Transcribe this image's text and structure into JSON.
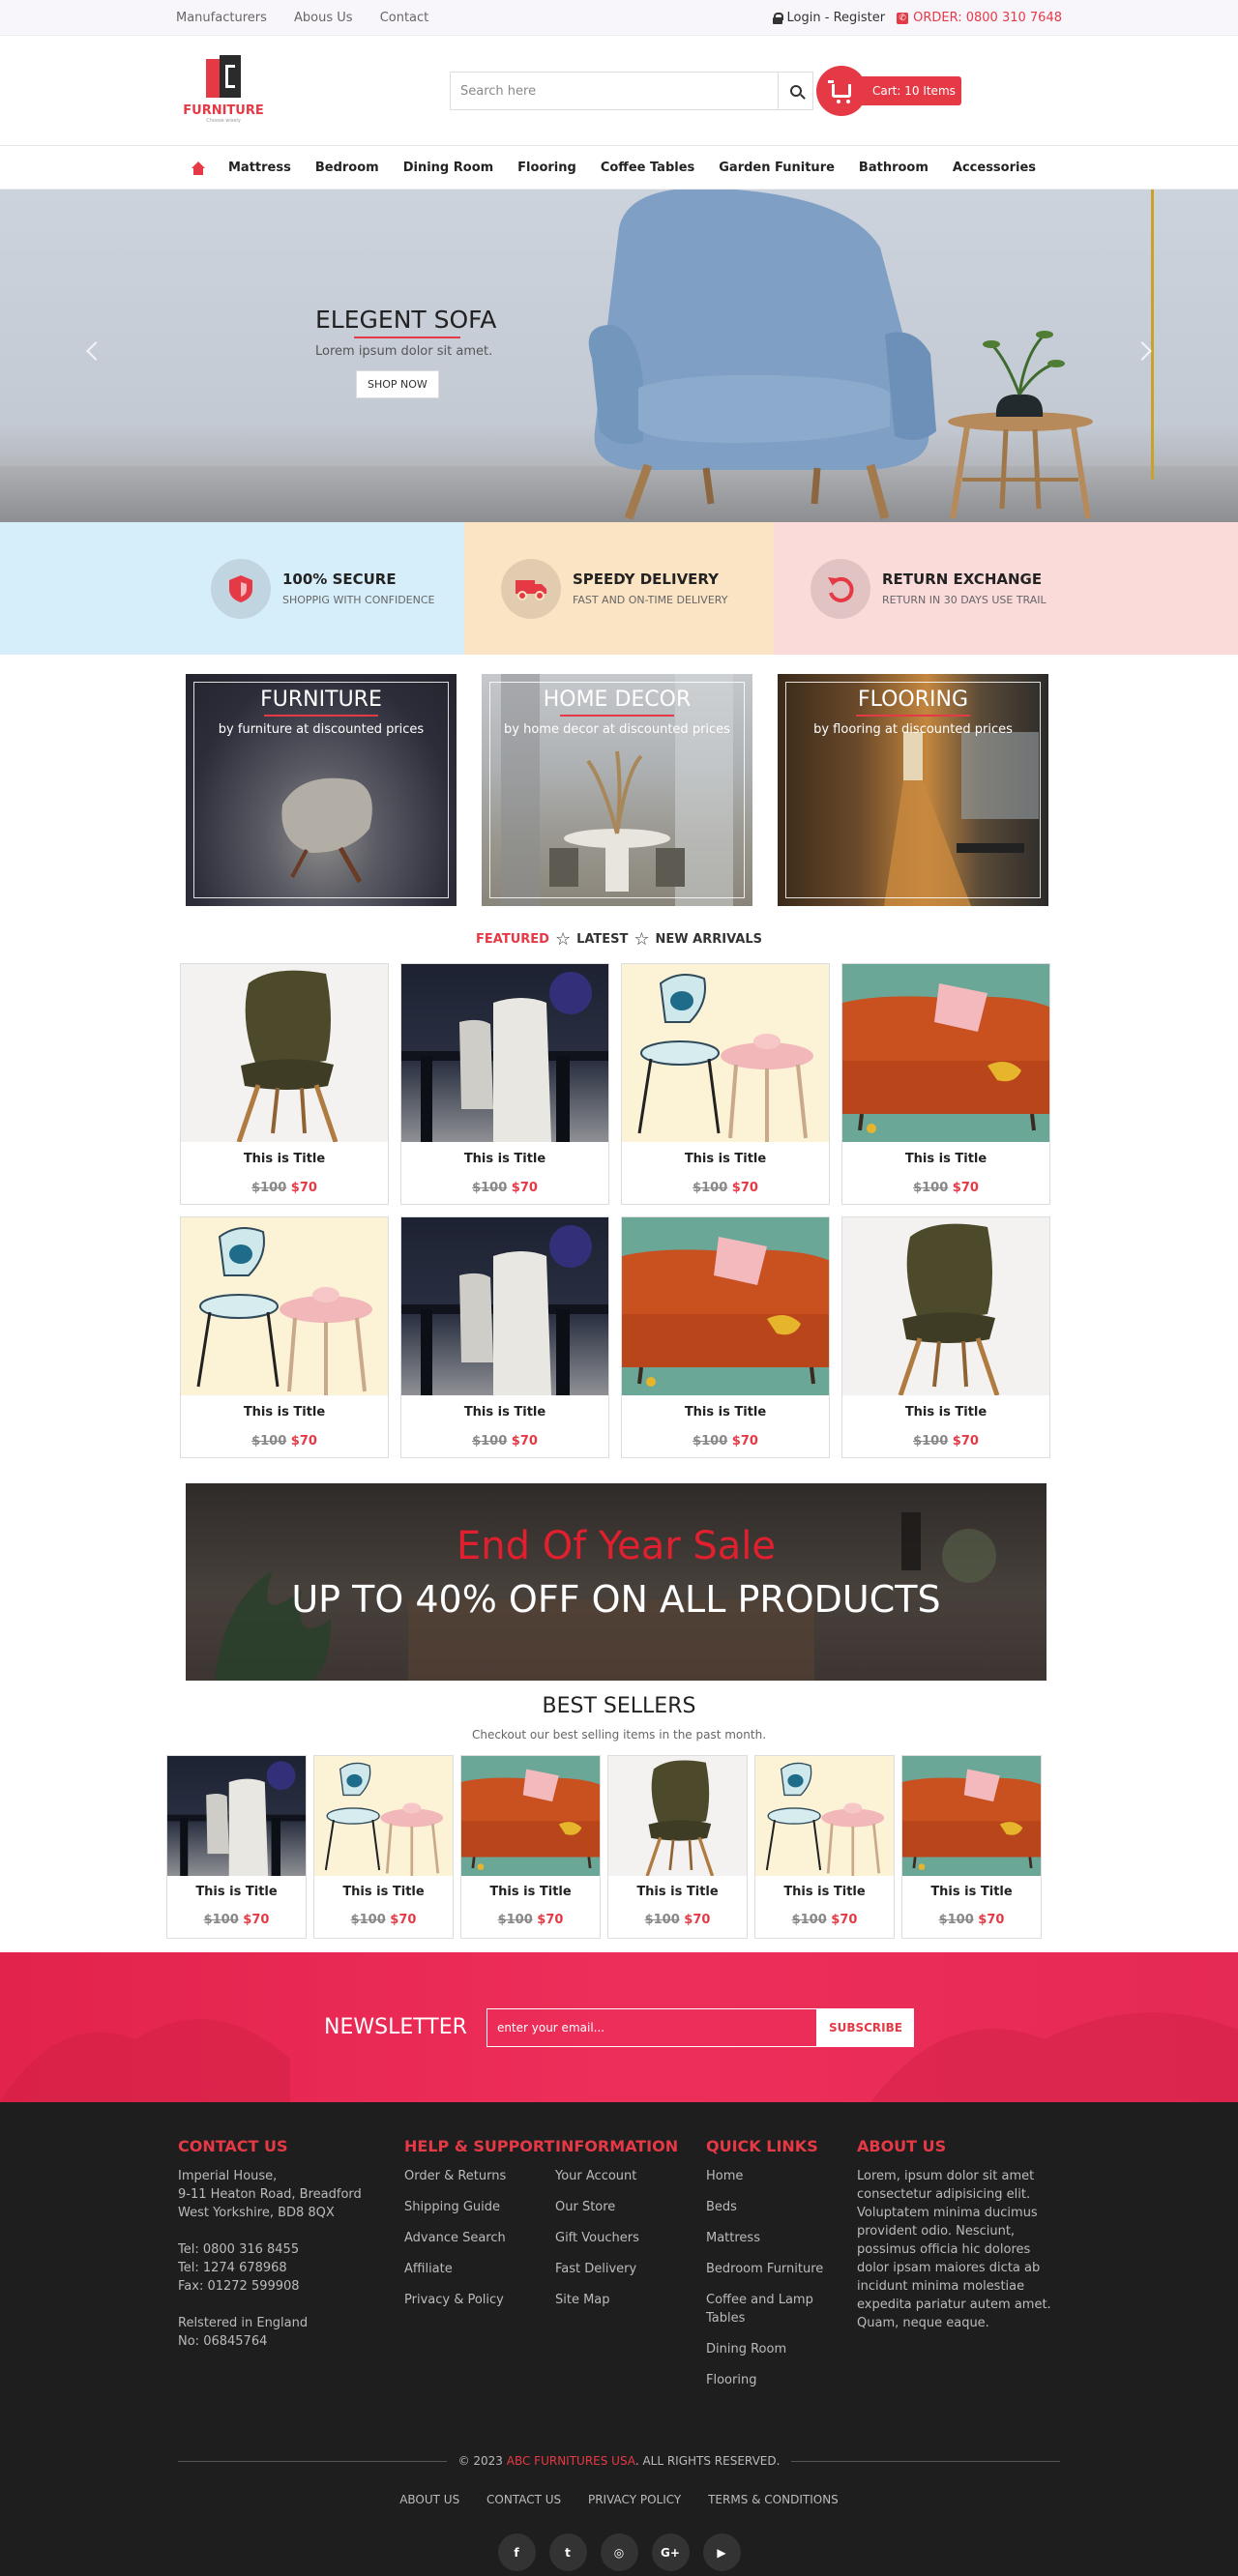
{
  "topbar": {
    "links": [
      "Manufacturers",
      "Abous Us",
      "Contact"
    ],
    "login": "Login - Register",
    "order": "ORDER: 0800 310 7648"
  },
  "header": {
    "logo_name": "FURNITURE",
    "logo_tag": "Choose wisely",
    "search_placeholder": "Search here",
    "cart_label": "Cart: 10 Items"
  },
  "nav": {
    "items": [
      "Mattress",
      "Bedroom",
      "Dining Room",
      "Flooring",
      "Coffee Tables",
      "Garden Funiture",
      "Bathroom",
      "Accessories"
    ]
  },
  "hero": {
    "title": "ELEGENT SOFA",
    "subtitle": "Lorem ipsum dolor sit amet.",
    "cta": "SHOP NOW"
  },
  "features": [
    {
      "title": "100% SECURE",
      "sub": "SHOPPIG WITH CONFIDENCE",
      "icon": "shield-icon",
      "bg": "#d6eefa"
    },
    {
      "title": "SPEEDY DELIVERY",
      "sub": "FAST AND ON-TIME DELIVERY",
      "icon": "truck-icon",
      "bg": "#fbe4c3"
    },
    {
      "title": "RETURN EXCHANGE",
      "sub": "RETURN IN 30 DAYS USE TRAIL",
      "icon": "return-icon",
      "bg": "#fbdada"
    }
  ],
  "categories": [
    {
      "title": "FURNITURE",
      "sub": "by furniture at discounted prices"
    },
    {
      "title": "HOME DECOR",
      "sub": "by home decor at discounted prices"
    },
    {
      "title": "FLOORING",
      "sub": "by flooring at discounted prices"
    }
  ],
  "tabs": [
    "FEATURED",
    "LATEST",
    "NEW ARRIVALS"
  ],
  "products": [
    {
      "title": "This is Title",
      "old": "$100",
      "new": "$70",
      "art": "chair-green"
    },
    {
      "title": "This is Title",
      "old": "$100",
      "new": "$70",
      "art": "dining"
    },
    {
      "title": "This is Title",
      "old": "$100",
      "new": "$70",
      "art": "chair-table"
    },
    {
      "title": "This is Title",
      "old": "$100",
      "new": "$70",
      "art": "sofa"
    },
    {
      "title": "This is Title",
      "old": "$100",
      "new": "$70",
      "art": "chair-table"
    },
    {
      "title": "This is Title",
      "old": "$100",
      "new": "$70",
      "art": "dining"
    },
    {
      "title": "This is Title",
      "old": "$100",
      "new": "$70",
      "art": "sofa"
    },
    {
      "title": "This is Title",
      "old": "$100",
      "new": "$70",
      "art": "chair-green"
    }
  ],
  "banner": {
    "line1": "End Of Year Sale",
    "line2": "UP TO 40% OFF ON ALL PRODUCTS"
  },
  "bestsellers": {
    "title": "BEST SELLERS",
    "subtitle": "Checkout our best selling items in the past month.",
    "items": [
      {
        "title": "This is Title",
        "old": "$100",
        "new": "$70",
        "art": "dining"
      },
      {
        "title": "This is Title",
        "old": "$100",
        "new": "$70",
        "art": "chair-table"
      },
      {
        "title": "This is Title",
        "old": "$100",
        "new": "$70",
        "art": "sofa"
      },
      {
        "title": "This is Title",
        "old": "$100",
        "new": "$70",
        "art": "chair-green"
      },
      {
        "title": "This is Title",
        "old": "$100",
        "new": "$70",
        "art": "chair-table"
      },
      {
        "title": "This is Title",
        "old": "$100",
        "new": "$70",
        "art": "sofa"
      }
    ]
  },
  "newsletter": {
    "label": "NEWSLETTER",
    "placeholder": "enter your email...",
    "button": "SUBSCRIBE"
  },
  "footer": {
    "contact": {
      "title": "CONTACT US",
      "addr1": "Imperial House,",
      "addr2": "9-11 Heaton Road, Breadford",
      "addr3": "West Yorkshire, BD8 8QX",
      "tel1": "Tel: 0800 316 8455",
      "tel2": "Tel: 1274 678968",
      "fax": "Fax: 01272 599908",
      "reg1": "Relstered in England",
      "reg2": "No: 06845764"
    },
    "help": {
      "title": "HELP & SUPPORT",
      "links": [
        "Order & Returns",
        "Shipping Guide",
        "Advance Search",
        "Affiliate",
        "Privacy & Policy"
      ]
    },
    "info": {
      "title": "INFORMATION",
      "links": [
        "Your Account",
        "Our Store",
        "Gift Vouchers",
        "Fast Delivery",
        "Site Map"
      ]
    },
    "quick": {
      "title": "QUICK LINKS",
      "links": [
        "Home",
        "Beds",
        "Mattress",
        "Bedroom Furniture",
        "Coffee and Lamp Tables",
        "Dining Room",
        "Flooring"
      ]
    },
    "about": {
      "title": "ABOUT US",
      "text": "Lorem, ipsum dolor sit amet consectetur adipisicing elit. Voluptatem minima ducimus provident odio. Nesciunt, possimus officia hic dolores dolor ipsam maiores dicta ab incidunt minima molestiae expedita pariatur autem amet. Quam, neque eaque."
    },
    "copy_pre": "© 2023",
    "copy_brand": "ABC FURNITURES USA",
    "copy_post": ". ALL RIGHTS RESERVED.",
    "bottom_links": [
      "ABOUT US",
      "CONTACT US",
      "PRIVACY POLICY",
      "TERMS & CONDITIONS"
    ],
    "social": [
      {
        "icon": "facebook-icon",
        "glyph": "f"
      },
      {
        "icon": "twitter-icon",
        "glyph": "t"
      },
      {
        "icon": "instagram-icon",
        "glyph": "◎"
      },
      {
        "icon": "google-plus-icon",
        "glyph": "G+"
      },
      {
        "icon": "youtube-icon",
        "glyph": "▶"
      }
    ]
  }
}
